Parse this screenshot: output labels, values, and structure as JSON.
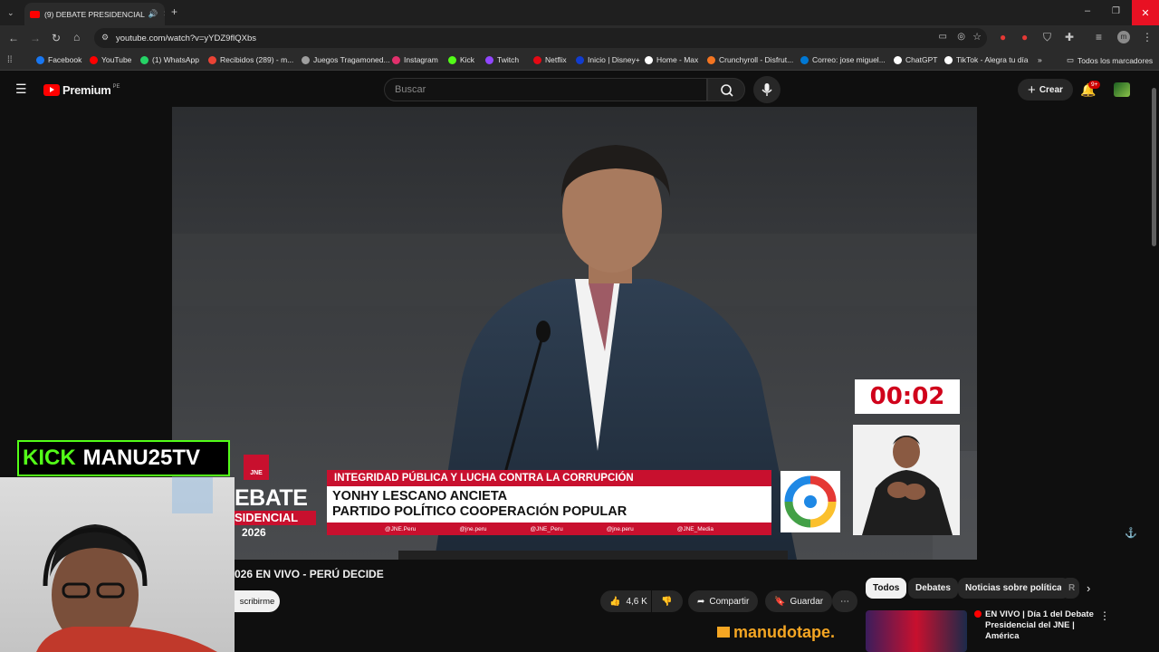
{
  "browser": {
    "tab_title": "(9) DEBATE PRESIDENCIAL",
    "url": "youtube.com/watch?v=yYDZ9flQXbs",
    "bookmarks": [
      {
        "label": "Facebook",
        "color": "#1877f2"
      },
      {
        "label": "YouTube",
        "color": "#ff0000"
      },
      {
        "label": "(1) WhatsApp",
        "color": "#25d366"
      },
      {
        "label": "Recibidos (289) - m...",
        "color": "#ea4335"
      },
      {
        "label": "Juegos Tragamoned...",
        "color": "#9e9e9e"
      },
      {
        "label": "Instagram",
        "color": "#e1306c"
      },
      {
        "label": "Kick",
        "color": "#53fc18"
      },
      {
        "label": "Twitch",
        "color": "#9146ff"
      },
      {
        "label": "Netflix",
        "color": "#e50914"
      },
      {
        "label": "Inicio | Disney+",
        "color": "#113ccf"
      },
      {
        "label": "Home - Max",
        "color": "#ffffff"
      },
      {
        "label": "Crunchyroll - Disfrut...",
        "color": "#f47521"
      },
      {
        "label": "Correo: jose miguel...",
        "color": "#0078d4"
      },
      {
        "label": "ChatGPT",
        "color": "#ffffff"
      },
      {
        "label": "TikTok - Alegra tu día",
        "color": "#ffffff"
      }
    ],
    "all_bookmarks": "Todos los marcadores"
  },
  "youtube": {
    "logo": "Premium",
    "logo_region": "PE",
    "search_placeholder": "Buscar",
    "create_label": "Crear",
    "notif_badge": "9+"
  },
  "video": {
    "timer": "00:02",
    "topic": "INTEGRIDAD PÚBLICA Y LUCHA CONTRA LA CORRUPCIÓN",
    "speaker_name": "YONHY LESCANO ANCIETA",
    "speaker_party": "PARTIDO POLÍTICO COOPERACIÓN POPULAR",
    "socials": [
      "@JNE.Peru",
      "@jne.peru",
      "@JNE_Peru",
      "@jne.peru",
      "@JNE_Media"
    ],
    "brand_jne": "JNE",
    "brand_line1": "EBATE",
    "brand_line2": "SIDENCIAL",
    "brand_year": "2026"
  },
  "overlay": {
    "kick_label": "KICK",
    "channel": "MANU25TV",
    "watermark": "manudotape."
  },
  "below": {
    "title": "026 EN VIVO - PERÚ DECIDE",
    "subscribe": "scribirme",
    "likes": "4,6 K",
    "share": "Compartir",
    "save": "Guardar",
    "chips": [
      "Todos",
      "Debates",
      "Noticias sobre política",
      "R"
    ],
    "related_title": "EN VIVO | Día 1 del Debate Presidencial del JNE | América"
  }
}
